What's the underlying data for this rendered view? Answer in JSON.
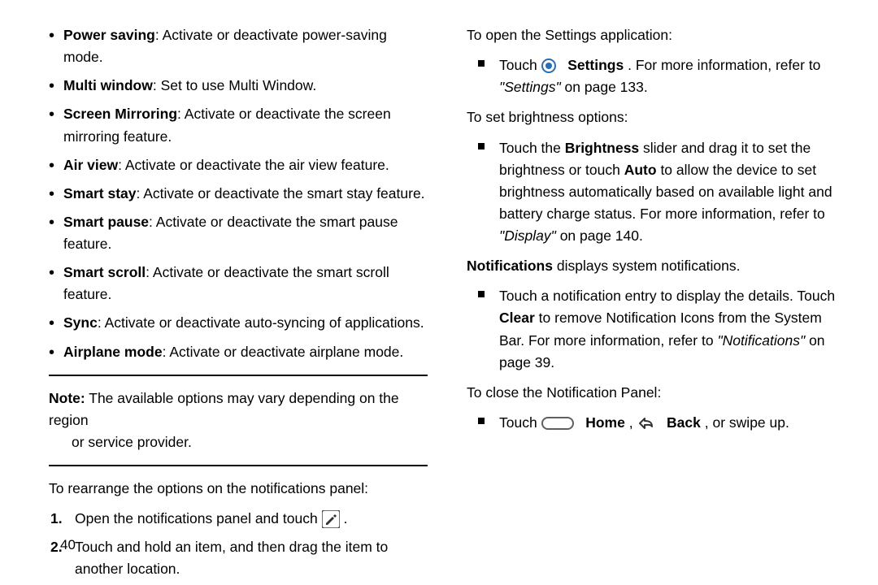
{
  "left": {
    "features": [
      {
        "term": "Power saving",
        "desc": ": Activate or deactivate power-saving mode."
      },
      {
        "term": "Multi window",
        "desc": ": Set to use Multi Window."
      },
      {
        "term": "Screen Mirroring",
        "desc": ": Activate or deactivate the screen mirroring feature."
      },
      {
        "term": "Air view",
        "desc": ": Activate or deactivate the air view feature."
      },
      {
        "term": "Smart stay",
        "desc": ": Activate or deactivate the smart stay feature."
      },
      {
        "term": "Smart pause",
        "desc": ": Activate or deactivate the smart pause feature."
      },
      {
        "term": "Smart scroll",
        "desc": ": Activate or deactivate the smart scroll feature."
      },
      {
        "term": "Sync",
        "desc": ": Activate or deactivate auto-syncing of applications."
      },
      {
        "term": "Airplane mode",
        "desc": ": Activate or deactivate airplane mode."
      }
    ],
    "note_label": "Note:",
    "note_text_line1": " The available options may vary depending on the region",
    "note_text_line2": "or service provider.",
    "rearrange_intro": "To rearrange the options on the notifications panel:",
    "steps": [
      {
        "num": "1.",
        "before": "Open the notifications panel and touch ",
        "after": "."
      },
      {
        "num": "2.",
        "text": "Touch and hold an item, and then drag the item to another location."
      }
    ]
  },
  "right": {
    "open_settings_intro": "To open the Settings application:",
    "open_settings_item": {
      "pre": "Touch ",
      "bold": "Settings",
      "post1": ". For more information, refer to ",
      "ref_italic": "\"Settings\"",
      "post2": " on page 133."
    },
    "brightness_intro": "To set brightness options:",
    "brightness_item": {
      "p1": "Touch the ",
      "b1": "Brightness",
      "p2": " slider and drag it to set the brightness or touch ",
      "b2": "Auto",
      "p3": " to allow the device to set brightness automatically based on available light and battery charge status. For more information, refer to ",
      "ref_italic": "\"Display\"",
      "p4": " on page 140."
    },
    "notifications_line": {
      "b": "Notifications",
      "rest": " displays system notifications."
    },
    "notifications_item": {
      "p1": "Touch a notification entry to display the details. Touch ",
      "b1": "Clear",
      "p2": " to remove Notification Icons from the System Bar. For more information, refer to ",
      "ref_italic": "\"Notifications\"",
      "p3": " on page 39."
    },
    "close_intro": "To close the Notification Panel:",
    "close_item": {
      "pre": "Touch ",
      "home_bold": "Home",
      "comma": ", ",
      "back_bold": "Back",
      "end": ", or swipe up."
    }
  },
  "page_number": "40"
}
